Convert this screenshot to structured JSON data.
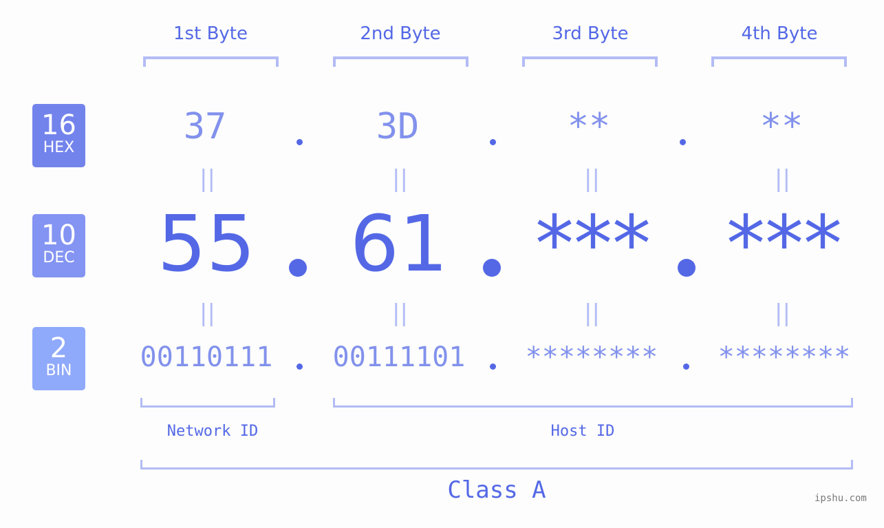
{
  "badges": [
    {
      "number": "16",
      "label": "HEX",
      "color": "#7383ec"
    },
    {
      "number": "10",
      "label": "DEC",
      "color": "#8494f2"
    },
    {
      "number": "2",
      "label": "BIN",
      "color": "#8fa9fb"
    }
  ],
  "bytes": [
    {
      "header": "1st Byte",
      "hex": "37",
      "dec": "55",
      "bin": "00110111"
    },
    {
      "header": "2nd Byte",
      "hex": "3D",
      "dec": "61",
      "bin": "00111101"
    },
    {
      "header": "3rd Byte",
      "hex": "**",
      "dec": "***",
      "bin": "********"
    },
    {
      "header": "4th Byte",
      "hex": "**",
      "dec": "***",
      "bin": "********"
    }
  ],
  "equals_sign": "||",
  "network_label": "Network ID",
  "host_label": "Host ID",
  "class_label": "Class A",
  "watermark": "ipshu.com",
  "colors": {
    "primary": "#5468e6",
    "secondary": "#8291ec",
    "bracket": "#b3bcf6"
  }
}
